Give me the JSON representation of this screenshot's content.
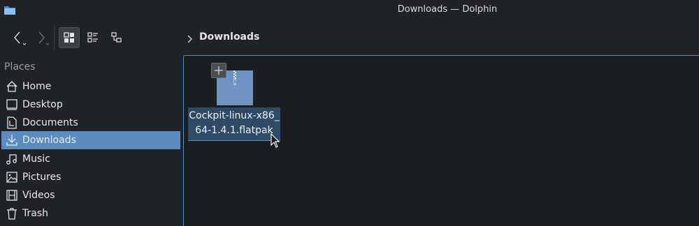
{
  "window": {
    "title": "Downloads — Dolphin"
  },
  "toolbar": {
    "back_icon": "chevron-left-icon",
    "forward_icon": "chevron-right-icon",
    "view_modes": [
      "icons-view",
      "compact-view",
      "details-view"
    ],
    "active_view": "icons-view"
  },
  "breadcrumb": {
    "current": "Downloads"
  },
  "sidebar": {
    "header": "Places",
    "items": [
      {
        "label": "Home",
        "icon": "home-icon"
      },
      {
        "label": "Desktop",
        "icon": "desktop-icon"
      },
      {
        "label": "Documents",
        "icon": "documents-icon"
      },
      {
        "label": "Downloads",
        "icon": "download-icon",
        "selected": true
      },
      {
        "label": "Music",
        "icon": "music-icon"
      },
      {
        "label": "Pictures",
        "icon": "pictures-icon"
      },
      {
        "label": "Videos",
        "icon": "videos-icon"
      },
      {
        "label": "Trash",
        "icon": "trash-icon"
      }
    ]
  },
  "files": [
    {
      "name_line1": "Cockpit-linux-x86_",
      "name_line2": "64-1.4.1.flatpak",
      "icon": "archive-file-icon",
      "selected": true
    }
  ],
  "colors": {
    "accent": "#5c8bbf",
    "background": "#202326",
    "view_background": "#1b1e20"
  }
}
